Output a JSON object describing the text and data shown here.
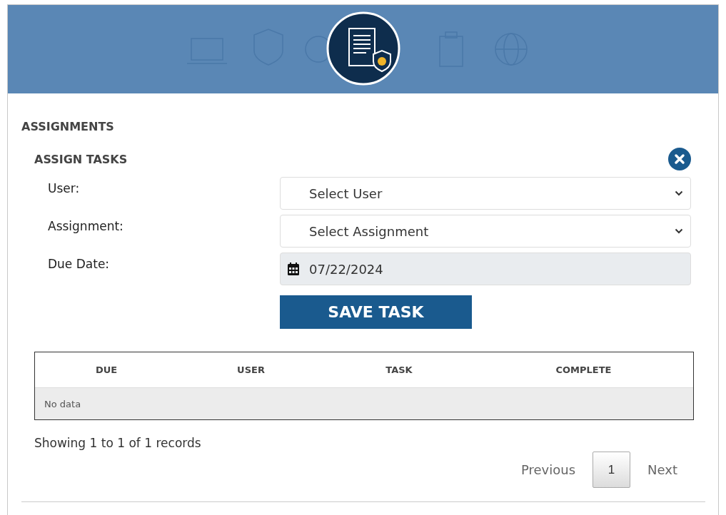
{
  "section_title": "ASSIGNMENTS",
  "panel": {
    "title": "ASSIGN TASKS",
    "fields": [
      {
        "kind": "select",
        "label": "User:",
        "value": "Select User"
      },
      {
        "kind": "select",
        "label": "Assignment:",
        "value": "Select Assignment"
      },
      {
        "kind": "date",
        "label": "Due Date:",
        "value": "07/22/2024"
      }
    ],
    "save_button": "SAVE TASK"
  },
  "table": {
    "columns": [
      "DUE",
      "USER",
      "TASK",
      "COMPLETE"
    ],
    "empty_text": "No data"
  },
  "summary": "Showing 1 to 1 of 1 records",
  "pagination": {
    "previous": "Previous",
    "pages": [
      {
        "label": "1",
        "selected": true
      }
    ],
    "next": "Next"
  }
}
